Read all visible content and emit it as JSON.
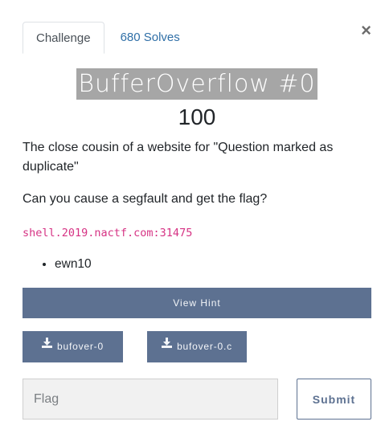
{
  "tabs": {
    "challenge": "Challenge",
    "solves": "680 Solves"
  },
  "close_symbol": "×",
  "challenge": {
    "name": "BufferOverflow #0",
    "points": "100",
    "description": "The close cousin of a website for \"Question marked as duplicate\"",
    "question": "Can you cause a segfault and get the flag?",
    "connection": "shell.2019.nactf.com:31475",
    "tags": [
      "ewn10"
    ]
  },
  "buttons": {
    "hint": "View Hint",
    "files": [
      {
        "label": "bufover-0"
      },
      {
        "label": "bufover-0.c"
      }
    ],
    "submit": "Submit"
  },
  "flag_input": {
    "placeholder": "Flag",
    "value": ""
  },
  "colors": {
    "button_bg": "#5d7191",
    "title_highlight": "#a6a6a6",
    "code_color": "#d63384",
    "link_color": "#2f6fa7"
  },
  "icons": {
    "download": "download-icon",
    "close": "close-icon"
  }
}
